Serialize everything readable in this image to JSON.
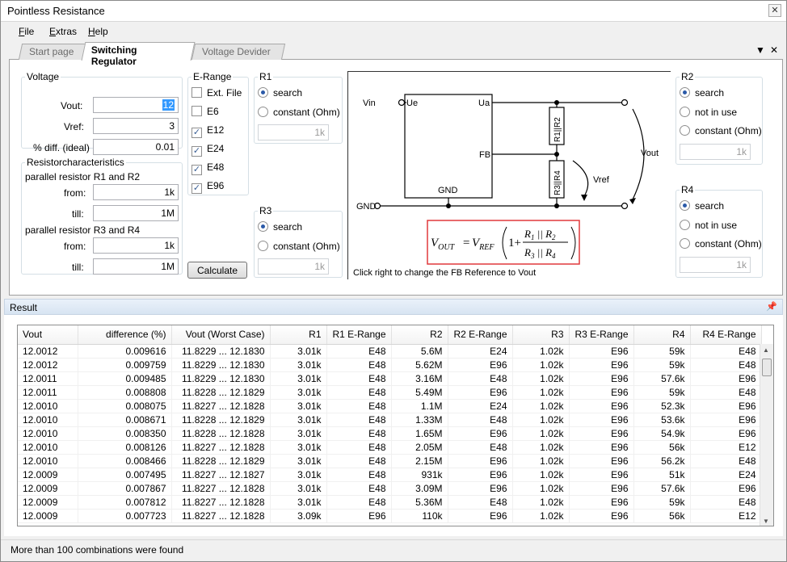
{
  "window": {
    "title": "Pointless Resistance"
  },
  "menu": [
    "File",
    "Extras",
    "Help"
  ],
  "tabs": [
    "Start page",
    "Switching Regulator",
    "Voltage Devider"
  ],
  "voltage": {
    "legend": "Voltage",
    "vout_label": "Vout:",
    "vout_value": "12",
    "vref_label": "Vref:",
    "vref_value": "3",
    "diff_label": "% diff. (ideal)",
    "diff_value": "0.01"
  },
  "resistorchar": {
    "legend": "Resistorcharacteristics",
    "group1": "parallel resistor R1 and R2",
    "group2": "parallel resistor R3 and R4",
    "from_label": "from:",
    "till_label": "till:",
    "r12_from": "1k",
    "r12_till": "1M",
    "r34_from": "1k",
    "r34_till": "1M"
  },
  "erange": {
    "legend": "E-Range",
    "items": [
      {
        "label": "Ext. File",
        "checked": false
      },
      {
        "label": "E6",
        "checked": false
      },
      {
        "label": "E12",
        "checked": true
      },
      {
        "label": "E24",
        "checked": true
      },
      {
        "label": "E48",
        "checked": true
      },
      {
        "label": "E96",
        "checked": true
      }
    ]
  },
  "r1": {
    "legend": "R1",
    "opt_search": "search",
    "opt_constant": "constant (Ohm)",
    "value": "1k"
  },
  "r3": {
    "legend": "R3",
    "opt_search": "search",
    "opt_constant": "constant (Ohm)",
    "value": "1k"
  },
  "r2": {
    "legend": "R2",
    "opt_search": "search",
    "opt_notinuse": "not in use",
    "opt_constant": "constant (Ohm)",
    "value": "1k"
  },
  "r4": {
    "legend": "R4",
    "opt_search": "search",
    "opt_notinuse": "not in use",
    "opt_constant": "constant (Ohm)",
    "value": "1k"
  },
  "calculate_label": "Calculate",
  "schematic": {
    "vin": "Vin",
    "ue": "Ue",
    "ua": "Ua",
    "fb": "FB",
    "gnd_ic": "GND",
    "gnd": "GND",
    "r12": "R1||R2",
    "r34": "R3||R4",
    "vout": "Vout",
    "vref": "Vref",
    "hint": "Click right to change the FB Reference to Vout"
  },
  "result": {
    "title": "Result",
    "columns": [
      "Vout",
      "difference (%)",
      "Vout (Worst Case)",
      "R1",
      "R1 E-Range",
      "R2",
      "R2 E-Range",
      "R3",
      "R3 E-Range",
      "R4",
      "R4 E-Range"
    ],
    "rows": [
      [
        "12.0012",
        "0.009616",
        "11.8229 ... 12.1830",
        "3.01k",
        "E48",
        "5.6M",
        "E24",
        "1.02k",
        "E96",
        "59k",
        "E48"
      ],
      [
        "12.0012",
        "0.009759",
        "11.8229 ... 12.1830",
        "3.01k",
        "E48",
        "5.62M",
        "E96",
        "1.02k",
        "E96",
        "59k",
        "E48"
      ],
      [
        "12.0011",
        "0.009485",
        "11.8229 ... 12.1830",
        "3.01k",
        "E48",
        "3.16M",
        "E48",
        "1.02k",
        "E96",
        "57.6k",
        "E96"
      ],
      [
        "12.0011",
        "0.008808",
        "11.8228 ... 12.1829",
        "3.01k",
        "E48",
        "5.49M",
        "E96",
        "1.02k",
        "E96",
        "59k",
        "E48"
      ],
      [
        "12.0010",
        "0.008075",
        "11.8227 ... 12.1828",
        "3.01k",
        "E48",
        "1.1M",
        "E24",
        "1.02k",
        "E96",
        "52.3k",
        "E96"
      ],
      [
        "12.0010",
        "0.008671",
        "11.8228 ... 12.1829",
        "3.01k",
        "E48",
        "1.33M",
        "E48",
        "1.02k",
        "E96",
        "53.6k",
        "E96"
      ],
      [
        "12.0010",
        "0.008350",
        "11.8228 ... 12.1828",
        "3.01k",
        "E48",
        "1.65M",
        "E96",
        "1.02k",
        "E96",
        "54.9k",
        "E96"
      ],
      [
        "12.0010",
        "0.008126",
        "11.8227 ... 12.1828",
        "3.01k",
        "E48",
        "2.05M",
        "E48",
        "1.02k",
        "E96",
        "56k",
        "E12"
      ],
      [
        "12.0010",
        "0.008466",
        "11.8228 ... 12.1829",
        "3.01k",
        "E48",
        "2.15M",
        "E96",
        "1.02k",
        "E96",
        "56.2k",
        "E48"
      ],
      [
        "12.0009",
        "0.007495",
        "11.8227 ... 12.1827",
        "3.01k",
        "E48",
        "931k",
        "E96",
        "1.02k",
        "E96",
        "51k",
        "E24"
      ],
      [
        "12.0009",
        "0.007867",
        "11.8227 ... 12.1828",
        "3.01k",
        "E48",
        "3.09M",
        "E96",
        "1.02k",
        "E96",
        "57.6k",
        "E96"
      ],
      [
        "12.0009",
        "0.007812",
        "11.8227 ... 12.1828",
        "3.01k",
        "E48",
        "5.36M",
        "E48",
        "1.02k",
        "E96",
        "59k",
        "E48"
      ],
      [
        "12.0009",
        "0.007723",
        "11.8227 ... 12.1828",
        "3.09k",
        "E96",
        "110k",
        "E96",
        "1.02k",
        "E96",
        "56k",
        "E12"
      ]
    ]
  },
  "status": "More than 100 combinations were found"
}
